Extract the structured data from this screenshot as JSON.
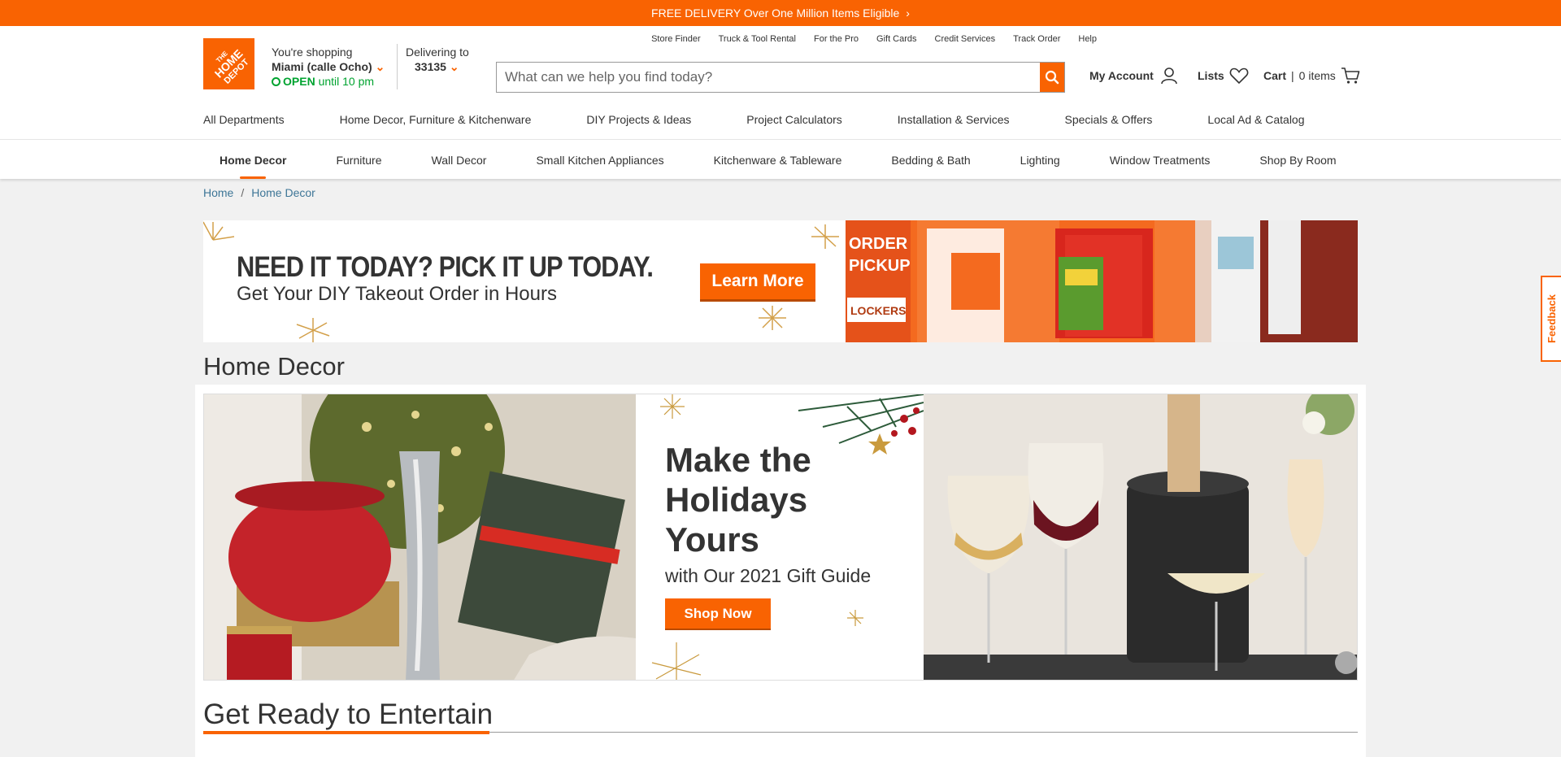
{
  "promo": {
    "text": "FREE DELIVERY Over One Million Items Eligible",
    "chevron": "›"
  },
  "header": {
    "logo_text": "THE HOME DEPOT",
    "store": {
      "label": "You're shopping",
      "name": "Miami (calle Ocho)",
      "status": "OPEN",
      "hours": "until 10 pm"
    },
    "delivery": {
      "label": "Delivering to",
      "zip": "33135"
    },
    "utility_links": [
      "Store Finder",
      "Truck & Tool Rental",
      "For the Pro",
      "Gift Cards",
      "Credit Services",
      "Track Order",
      "Help"
    ],
    "search": {
      "placeholder": "What can we help you find today?"
    },
    "account_label": "My Account",
    "lists_label": "Lists",
    "cart": {
      "label": "Cart",
      "sep": "|",
      "count": "0 items"
    },
    "main_nav": [
      "All Departments",
      "Home Decor, Furniture & Kitchenware",
      "DIY Projects & Ideas",
      "Project Calculators",
      "Installation & Services",
      "Specials & Offers",
      "Local Ad & Catalog"
    ]
  },
  "subnav": [
    "Home Decor",
    "Furniture",
    "Wall Decor",
    "Small Kitchen Appliances",
    "Kitchenware & Tableware",
    "Bedding & Bath",
    "Lighting",
    "Window Treatments",
    "Shop By Room"
  ],
  "breadcrumb": [
    "Home",
    "Home Decor"
  ],
  "banner": {
    "headline": "NEED IT TODAY? PICK IT UP TODAY.",
    "subline": "Get Your DIY Takeout Order in Hours",
    "button": "Learn More",
    "locker_text": [
      "ORDER",
      "PICKUP",
      "LOCKERS"
    ]
  },
  "page_title": "Home Decor",
  "hero": {
    "title": "Make the Holidays Yours",
    "subtitle": "with Our 2021 Gift Guide",
    "button": "Shop Now"
  },
  "section": {
    "title": "Get Ready to Entertain"
  },
  "feedback": "Feedback",
  "colors": {
    "brand": "#f96302",
    "link": "#3e7697",
    "open": "#00a330"
  }
}
